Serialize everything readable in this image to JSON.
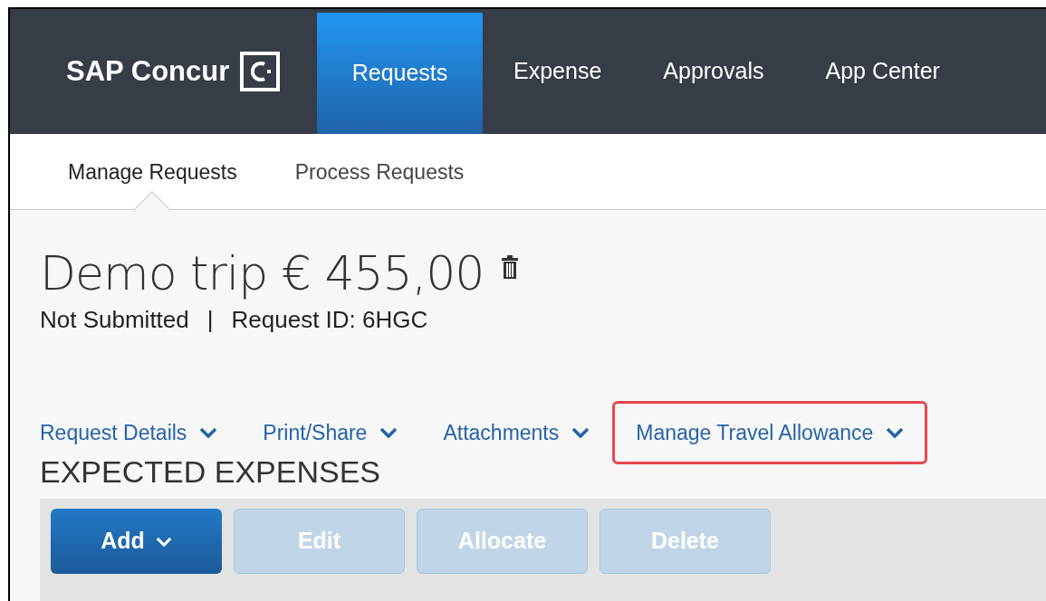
{
  "nav": {
    "brand": "SAP Concur",
    "tabs": [
      {
        "label": "Requests",
        "selected": true
      },
      {
        "label": "Expense",
        "selected": false
      },
      {
        "label": "Approvals",
        "selected": false
      },
      {
        "label": "App Center",
        "selected": false
      }
    ]
  },
  "subnav": [
    {
      "label": "Manage Requests",
      "selected": true
    },
    {
      "label": "Process Requests",
      "selected": false
    }
  ],
  "request": {
    "title": "Demo trip € 455,00",
    "status": "Not Submitted",
    "separator": "|",
    "request_id": "Request ID: 6HGC"
  },
  "actions": [
    {
      "label": "Request Details",
      "highlighted": false
    },
    {
      "label": "Print/Share",
      "highlighted": false
    },
    {
      "label": "Attachments",
      "highlighted": false
    },
    {
      "label": "Manage Travel Allowance",
      "highlighted": true
    }
  ],
  "section_title": "EXPECTED EXPENSES",
  "buttons": [
    {
      "label": "Add",
      "disabled": false,
      "dropdown": true
    },
    {
      "label": "Edit",
      "disabled": true,
      "dropdown": false
    },
    {
      "label": "Allocate",
      "disabled": true,
      "dropdown": false
    },
    {
      "label": "Delete",
      "disabled": true,
      "dropdown": false
    }
  ]
}
